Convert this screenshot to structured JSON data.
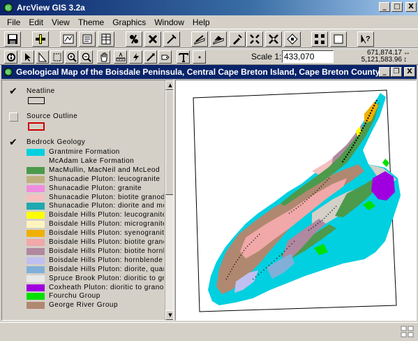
{
  "app": {
    "title": "ArcView GIS 3.2a"
  },
  "window_controls": {
    "minimize": "_",
    "maximize": "□",
    "close": "X"
  },
  "menu": [
    "File",
    "Edit",
    "View",
    "Theme",
    "Graphics",
    "Window",
    "Help"
  ],
  "toolbar1": {
    "icons": [
      "save-icon",
      "add-theme-icon",
      "theme-properties-icon",
      "edit-legend-icon",
      "open-attributes-table-icon",
      "query-builder-icon",
      "locate-address-icon",
      "hot-link-icon",
      "chart-icon",
      "layout-icon",
      "create-table-icon",
      "zoom-to-full-extent-icon",
      "zoom-to-active-themes-icon",
      "zoom-to-selected-icon",
      "select-by-theme-icon",
      "clear-selection-icon",
      "help-icon"
    ]
  },
  "toolbar2": {
    "icons": [
      "identify-icon",
      "pointer-icon",
      "vertex-edit-icon",
      "select-feature-icon",
      "zoom-in-icon",
      "zoom-out-icon",
      "pan-icon",
      "measure-icon",
      "hot-link-tool-icon",
      "area-of-interest-icon",
      "label-icon",
      "text-tool-icon",
      "draw-point-icon"
    ],
    "scale_label": "Scale 1:",
    "scale_value": "433,070",
    "coord_x": "671,874.17",
    "coord_y": "5,121,583.96",
    "coord_x_arrow": "↔",
    "coord_y_arrow": "↕"
  },
  "view": {
    "title": "Geological Map of the Boisdale Peninsula, Central Cape Breton Island, Cape Breton County,..."
  },
  "toc": {
    "themes": [
      {
        "name": "Neatline",
        "checked": true
      },
      {
        "name": "Source Outline",
        "checked": false
      },
      {
        "name": "Bedrock Geology",
        "checked": true
      }
    ],
    "neatline_symbol_color": "#000000",
    "source_outline_color": "#cc0000",
    "legend": [
      {
        "label": "Grantmire Formation",
        "color": "#00d0e0"
      },
      {
        "label": "McAdam Lake Formation",
        "color": "#d4d0c8"
      },
      {
        "label": "MacMullin, MacNeil and McLeod",
        "color": "#4c9a4c"
      },
      {
        "label": "Shunacadie Pluton: leucogranite",
        "color": "#c0b080"
      },
      {
        "label": "Shunacadie Pluton: granite",
        "color": "#f08ce0"
      },
      {
        "label": "Shunacadie Pluton: biotite granodiorite",
        "color": "#f4c0c0"
      },
      {
        "label": "Shunacadie Pluton: diorite and monzodiorite",
        "color": "#20a8b0"
      },
      {
        "label": "Boisdale Hills Pluton: leucogranite",
        "color": "#ffff00"
      },
      {
        "label": "Boisdale Hills Pluton: microgranite",
        "color": "#fff4c0"
      },
      {
        "label": "Boisdale Hills Pluton: syenogranite",
        "color": "#f0b000"
      },
      {
        "label": "Boisdale Hills Pluton: biotite granodiorite",
        "color": "#f0a8a8"
      },
      {
        "label": "Boisdale Hills Pluton: biotite hornblende",
        "color": "#b088a0"
      },
      {
        "label": "Boisdale Hills Pluton: hornblende",
        "color": "#c0c0f0"
      },
      {
        "label": "Boisdale Hills Pluton: diorite, quartz diorite",
        "color": "#80b0d8"
      },
      {
        "label": "Spruce Brook Pluton: dioritic to granodioritic",
        "color": "#e8e8e8"
      },
      {
        "label": "Coxheath Pluton: dioritic to granodioritic",
        "color": "#a000e0"
      },
      {
        "label": "Fourchu Group",
        "color": "#00e000"
      },
      {
        "label": "George River Group",
        "color": "#b08870"
      }
    ]
  }
}
